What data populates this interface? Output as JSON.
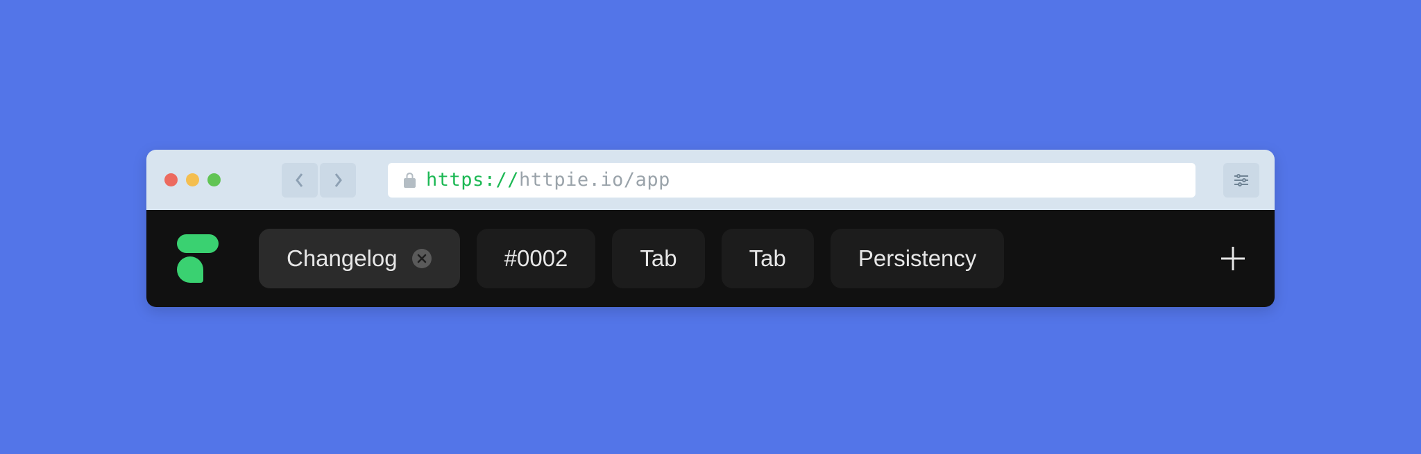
{
  "browser": {
    "url_scheme": "https://",
    "url_rest": "httpie.io/app"
  },
  "app": {
    "tabs": [
      {
        "label": "Changelog",
        "active": true,
        "closable": true
      },
      {
        "label": "#0002",
        "active": false,
        "closable": false
      },
      {
        "label": "Tab",
        "active": false,
        "closable": false
      },
      {
        "label": "Tab",
        "active": false,
        "closable": false
      },
      {
        "label": "Persistency",
        "active": false,
        "closable": false
      }
    ]
  }
}
